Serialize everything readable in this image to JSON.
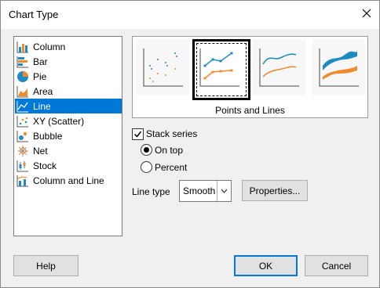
{
  "dialog": {
    "title": "Chart Type"
  },
  "chart_types": [
    {
      "label": "Column",
      "icon": "column-chart-icon"
    },
    {
      "label": "Bar",
      "icon": "bar-chart-icon"
    },
    {
      "label": "Pie",
      "icon": "pie-chart-icon"
    },
    {
      "label": "Area",
      "icon": "area-chart-icon"
    },
    {
      "label": "Line",
      "icon": "line-chart-icon",
      "selected": true
    },
    {
      "label": "XY (Scatter)",
      "icon": "xy-scatter-chart-icon"
    },
    {
      "label": "Bubble",
      "icon": "bubble-chart-icon"
    },
    {
      "label": "Net",
      "icon": "net-chart-icon"
    },
    {
      "label": "Stock",
      "icon": "stock-chart-icon"
    },
    {
      "label": "Column and Line",
      "icon": "column-and-line-chart-icon"
    }
  ],
  "variants": {
    "selected_label": "Points and Lines",
    "items": [
      "Points Only",
      "Points and Lines",
      "Lines Only",
      "3D Lines"
    ],
    "selected_index": 1
  },
  "options": {
    "stack_series": {
      "label": "Stack series",
      "checked": true
    },
    "on_top": {
      "label": "On top",
      "selected": true
    },
    "percent": {
      "label": "Percent",
      "selected": false
    },
    "line_type_label": "Line type",
    "line_type_value": "Smooth",
    "properties_label": "Properties..."
  },
  "buttons": {
    "help": "Help",
    "ok": "OK",
    "cancel": "Cancel"
  },
  "colors": {
    "accent": "#0078d7",
    "series_blue": "#1e8bc3",
    "series_orange": "#f08c2c"
  }
}
